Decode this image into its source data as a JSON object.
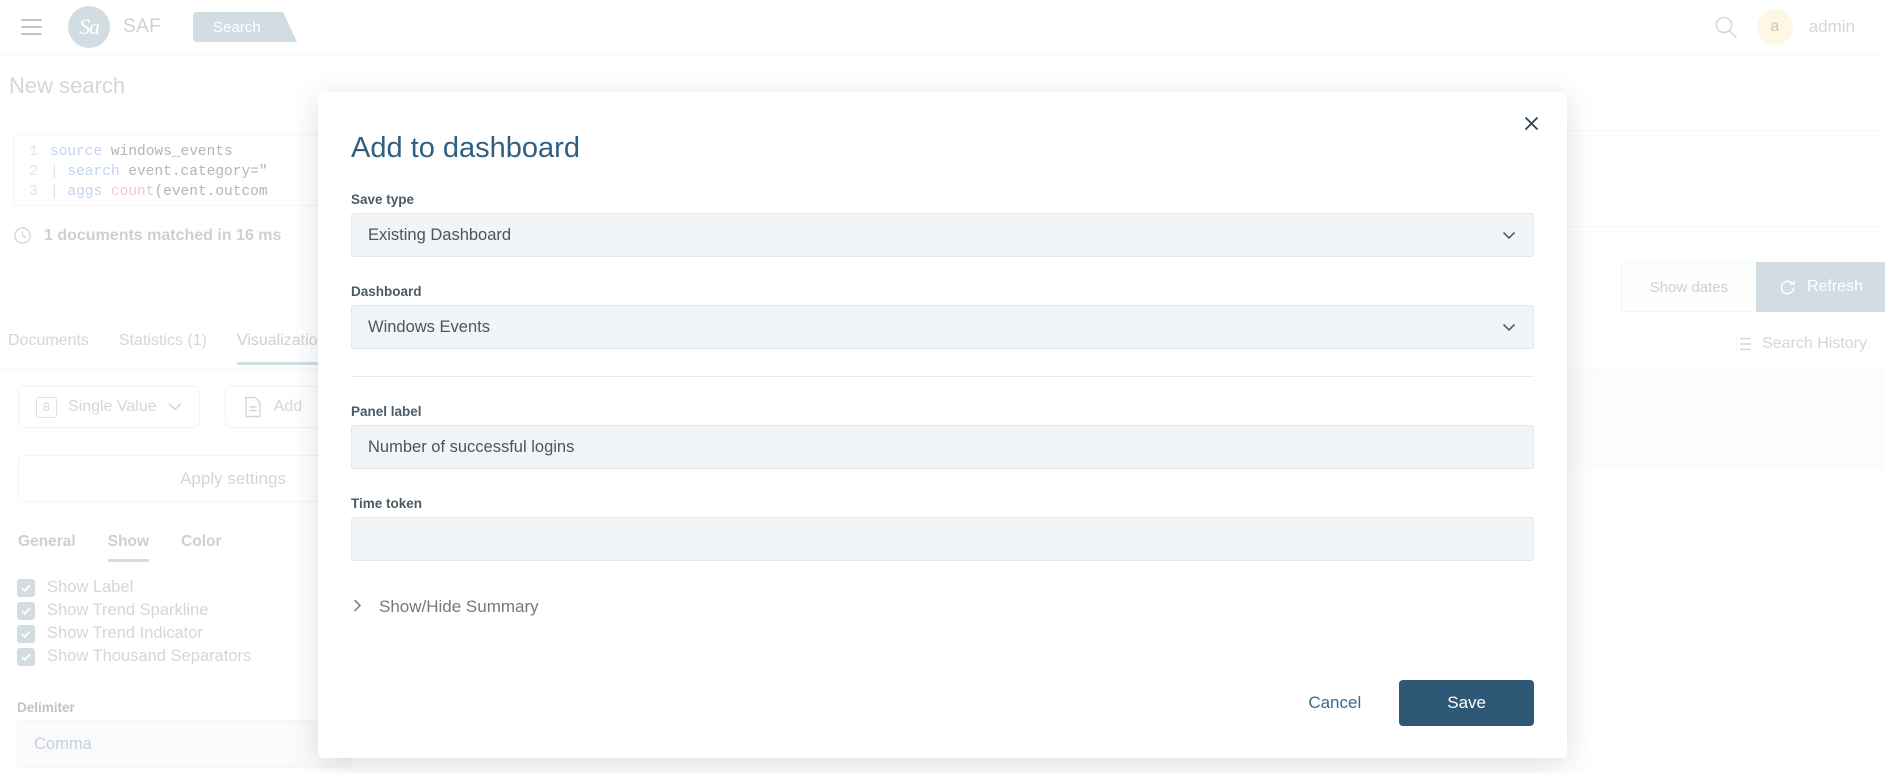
{
  "topbar": {
    "menu_icon": "hamburger-icon",
    "logo_text": "Sa",
    "brand": "SAF",
    "active_tab": "Search",
    "search_icon": "search-icon",
    "avatar_initial": "a",
    "username": "admin"
  },
  "page": {
    "title": "New search",
    "query_lines": [
      {
        "num": "1",
        "pipe": "",
        "cmd": "source",
        "rest": " windows_events"
      },
      {
        "num": "2",
        "pipe": "| ",
        "cmd": "search",
        "rest": " event.category=\""
      },
      {
        "num": "3",
        "pipe": "| ",
        "cmd": "aggs",
        "fn": " count",
        "rest": "(event.outcom"
      }
    ],
    "match_text": "1 documents matched in 16 ms",
    "clock_icon": "clock-icon",
    "show_dates": "Show dates",
    "refresh": "Refresh",
    "refresh_icon": "refresh-icon",
    "search_history": "Search History",
    "history_icon": "list-icon"
  },
  "tabs": [
    {
      "label": "Documents",
      "active": false
    },
    {
      "label": "Statistics (1)",
      "active": false
    },
    {
      "label": "Visualization",
      "active": true
    }
  ],
  "viz": {
    "type_button": "Single Value",
    "type_badge": "8",
    "add_button": "Add",
    "add_icon": "document-icon",
    "chevron_icon": "chevron-down-icon",
    "apply_settings": "Apply settings",
    "sub_tabs": [
      {
        "label": "General",
        "active": false
      },
      {
        "label": "Show",
        "active": true
      },
      {
        "label": "Color",
        "active": false
      }
    ],
    "checkboxes": [
      {
        "label": "Show Label",
        "checked": true
      },
      {
        "label": "Show Trend Sparkline",
        "checked": true
      },
      {
        "label": "Show Trend Indicator",
        "checked": true
      },
      {
        "label": "Show Thousand Separators",
        "checked": true
      }
    ],
    "delimiter_label": "Delimiter",
    "delimiter_value": "Comma"
  },
  "modal": {
    "title": "Add to dashboard",
    "close_icon": "close-icon",
    "save_type_label": "Save type",
    "save_type_value": "Existing Dashboard",
    "dashboard_label": "Dashboard",
    "dashboard_value": "Windows Events",
    "panel_label_label": "Panel label",
    "panel_label_value": "Number of successful logins",
    "time_token_label": "Time token",
    "time_token_value": "",
    "summary_toggle": "Show/Hide Summary",
    "summary_chevron_icon": "chevron-right-icon",
    "cancel_label": "Cancel",
    "save_label": "Save"
  },
  "colors": {
    "brand": "#9cb4c2",
    "primary": "#2f5876",
    "title": "#2f6084",
    "avatar_bg": "#fbeec3",
    "field_bg": "#f2f5f7"
  }
}
